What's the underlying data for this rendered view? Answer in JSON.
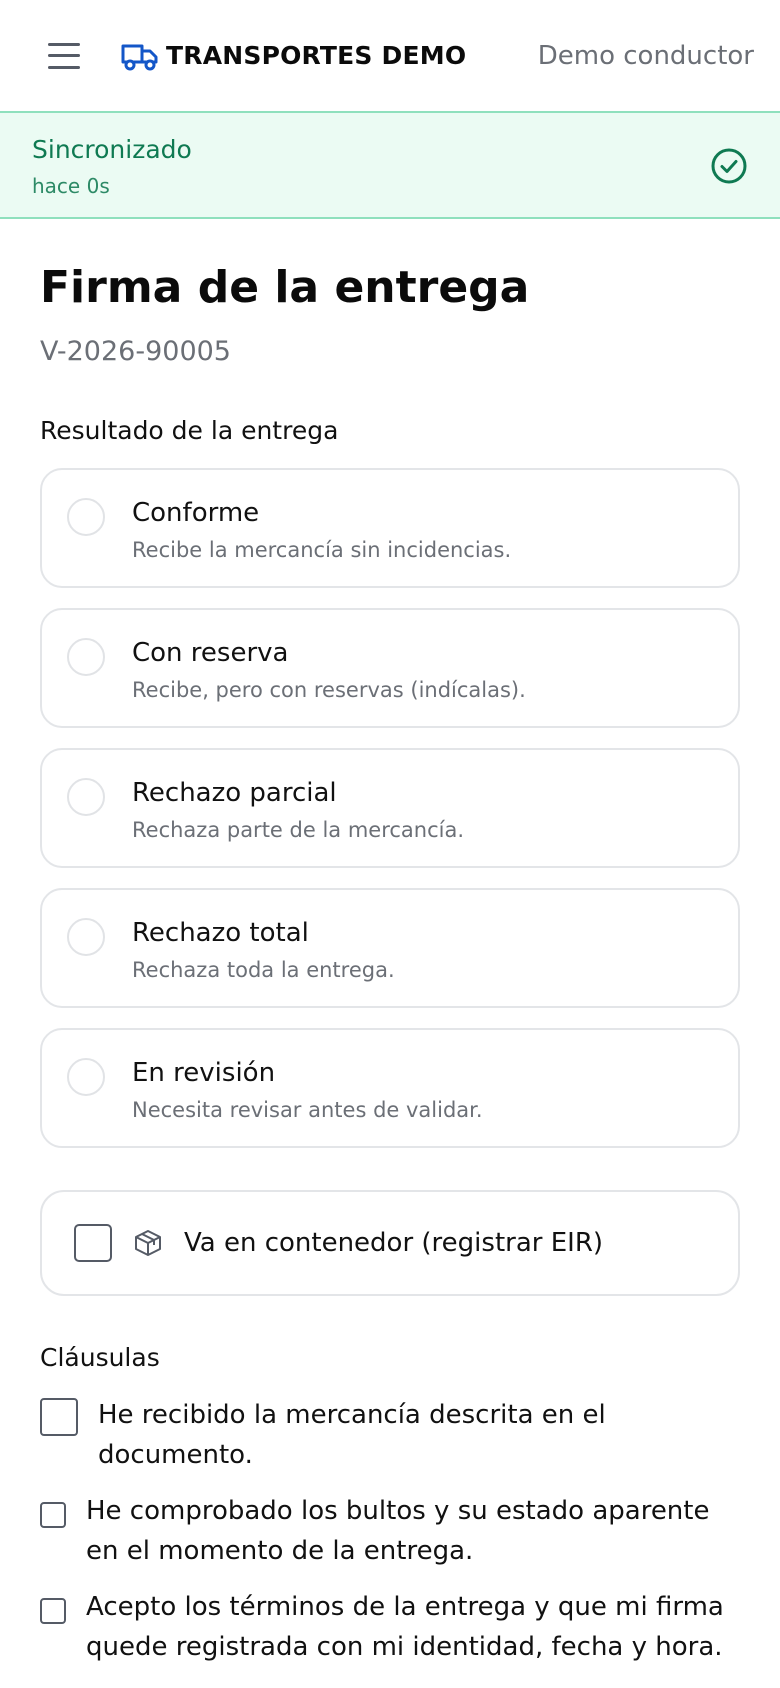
{
  "header": {
    "brand_name": "TRANSPORTES DEMO",
    "user_name": "Demo conductor",
    "brand_color": "#1356c8"
  },
  "sync": {
    "title": "Sincronizado",
    "time": "hace 0s",
    "color": "#0f7a52",
    "background": "#ebfbf3"
  },
  "page": {
    "title": "Firma de la entrega",
    "reference": "V-2026-90005",
    "result_label": "Resultado de la entrega",
    "clauses_label": "Cláusulas"
  },
  "result_options": [
    {
      "label": "Conforme",
      "description": "Recibe la mercancía sin incidencias.",
      "selected": false
    },
    {
      "label": "Con reserva",
      "description": "Recibe, pero con reservas (indícalas).",
      "selected": false
    },
    {
      "label": "Rechazo parcial",
      "description": "Rechaza parte de la mercancía.",
      "selected": false
    },
    {
      "label": "Rechazo total",
      "description": "Rechaza toda la entrega.",
      "selected": false
    },
    {
      "label": "En revisión",
      "description": "Necesita revisar antes de validar.",
      "selected": false
    }
  ],
  "container": {
    "label": "Va en contenedor (registrar EIR)",
    "checked": false,
    "icon": "box-icon"
  },
  "clauses": [
    {
      "text": "He recibido la mercancía descrita en el documento.",
      "checked": false
    },
    {
      "text": "He comprobado los bultos y su estado aparente en el momento de la entrega.",
      "checked": false
    },
    {
      "text": "Acepto los términos de la entrega y que mi firma quede registrada con mi identidad, fecha y hora.",
      "checked": false
    }
  ]
}
